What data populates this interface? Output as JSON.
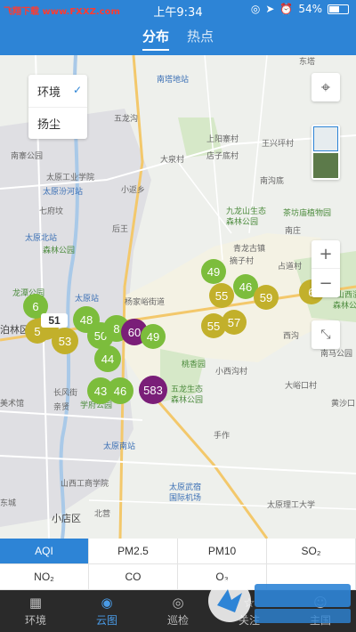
{
  "status": {
    "left_text": "飞翔下载 www.FXXZ.com",
    "time": "上午9:34",
    "battery": "54%"
  },
  "tabs": [
    "分布",
    "热点"
  ],
  "env_panel": {
    "items": [
      "环境",
      "扬尘"
    ]
  },
  "map_labels": {
    "l1": "南塔地站",
    "l2": "东塔",
    "l3": "五龙沟",
    "l4": "上阳寨村",
    "l5": "王兴坪村",
    "l6": "大泉村",
    "l7": "店子底村",
    "l8": "南寨公园",
    "l9": "太原工业学院",
    "l10": "太原汾河站",
    "l11": "七府坟",
    "l12": "小返乡",
    "l13": "南沟底",
    "l14": "后王",
    "l15": "九龙山生态",
    "l16": "森林公园",
    "l17": "茶坊庙植物园",
    "l18": "太原北站",
    "l19": "森林公园",
    "l20": "南庄",
    "l21": "青龙古镇",
    "l22": "摘子村",
    "l23": "占道村",
    "l24": "龙潭公园",
    "l25": "杨家峪街道",
    "l26": "太原站",
    "l27": "长风街",
    "l28": "学府公园",
    "l29": "五龙生态",
    "l30": "森林公园",
    "l31": "大峪口村",
    "l32": "太原南站",
    "l33": "手作",
    "l34": "山西工商学院",
    "l35": "太原武宿",
    "l36": "国际机场",
    "l37": "太原理工大学",
    "l38": "小店区",
    "l39": "东城",
    "l40": "北营",
    "l41": "小西沟村",
    "l42": "西沟",
    "l43": "泊林区",
    "l44": "山西溢",
    "l45": "森林公",
    "l46": "桃香园",
    "l47": "美术馆",
    "l48": "南马公园",
    "l49": "黄沙口",
    "l50": "亲贤"
  },
  "markers": {
    "m1": "49",
    "m2": "55",
    "m3": "46",
    "m4": "59",
    "m5": "6",
    "m6": "55",
    "m7": "57",
    "m8": "51",
    "m9": "53",
    "m10": "48",
    "m11": "50",
    "m12": "8",
    "m13": "60",
    "m14": "49",
    "m15": "6",
    "m16": "44",
    "m17": "43",
    "m18": "46",
    "m19": "583",
    "m20": "6",
    "m21": "5"
  },
  "pollutants": [
    "AQI",
    "PM2.5",
    "PM10",
    "SO₂",
    "NO₂",
    "CO",
    "O₃",
    ""
  ],
  "nav": [
    "环境",
    "云图",
    "巡检",
    "关注",
    "主国"
  ],
  "colors": {
    "primary": "#2d84d6",
    "good": "#7cbd3c",
    "moderate": "#c2b02b",
    "severe": "#7a1e78"
  },
  "icons": {
    "locate": "locate-icon",
    "layer": "layer-icon",
    "zoom_in": "plus-icon",
    "zoom_out": "minus-icon",
    "fullscreen": "collapse-icon"
  },
  "watermark": "飞翔下载 www.FXXZ.com"
}
